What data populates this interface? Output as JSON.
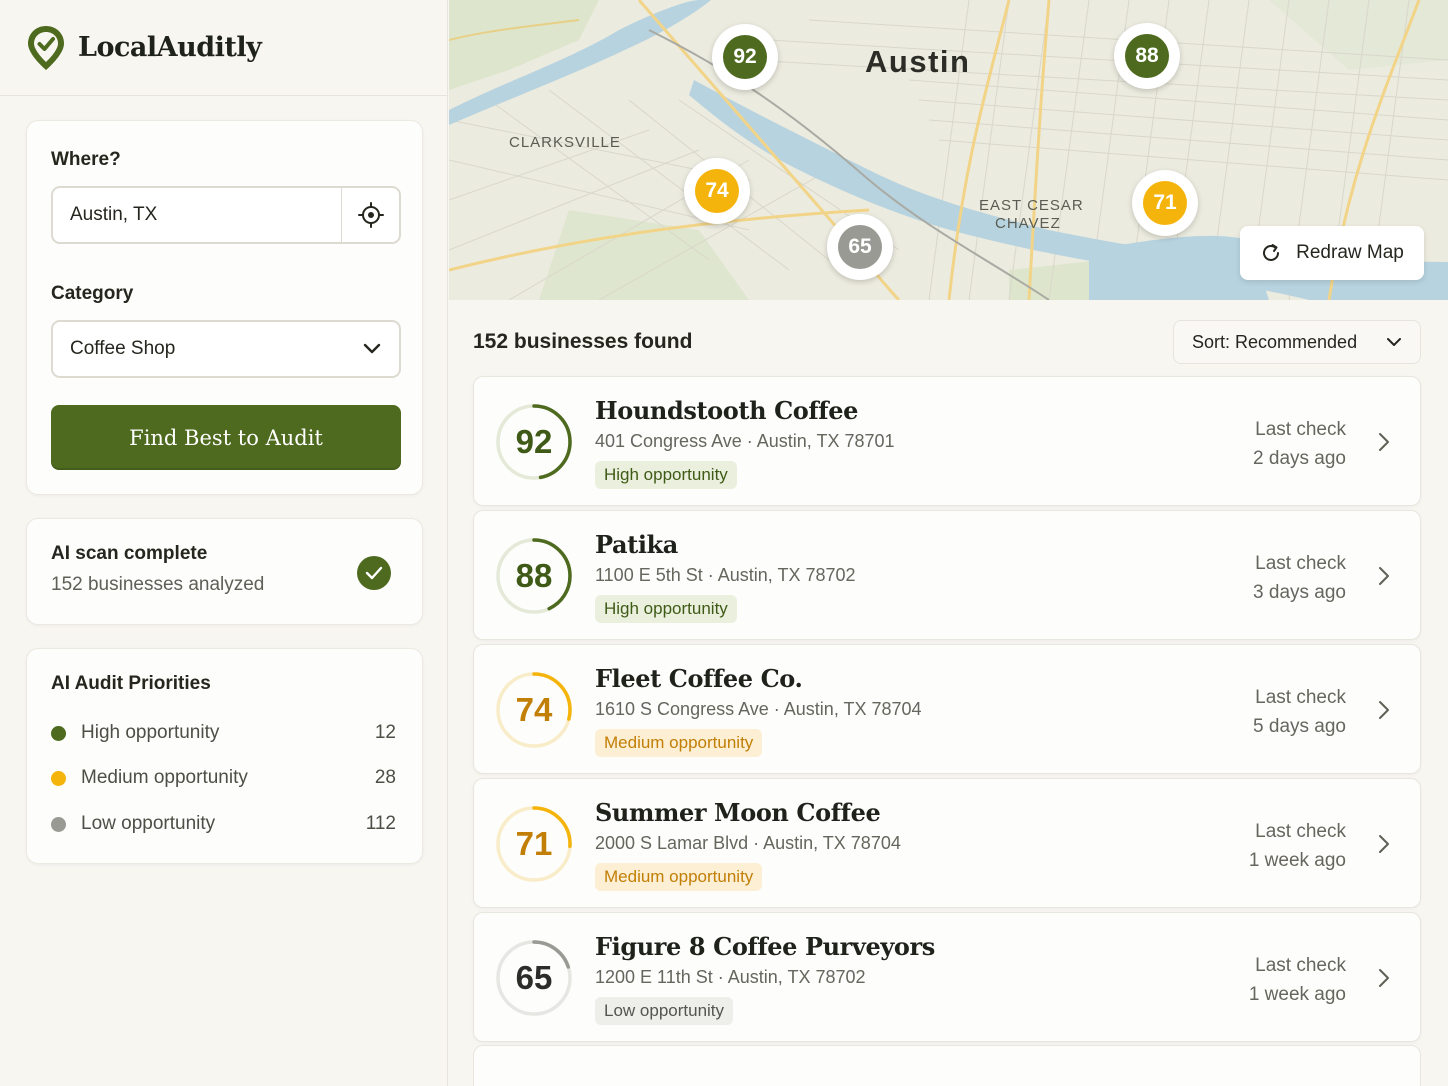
{
  "brand": {
    "name": "LocalAuditly",
    "icon": "map-pin-check-icon",
    "color": "#4d6a1e"
  },
  "search": {
    "where_label": "Where?",
    "location_value": "Austin, TX",
    "category_label": "Category",
    "category_value": "Coffee Shop",
    "submit_label": "Find Best to Audit"
  },
  "scan": {
    "title": "AI scan complete",
    "subtitle": "152 businesses analyzed"
  },
  "priorities": {
    "title": "AI Audit Priorities",
    "items": [
      {
        "label": "High opportunity",
        "count": "12",
        "color": "#4d6a1e"
      },
      {
        "label": "Medium opportunity",
        "count": "28",
        "color": "#f5b40b"
      },
      {
        "label": "Low opportunity",
        "count": "112",
        "color": "#9a9a94"
      }
    ]
  },
  "map": {
    "city_label": "Austin",
    "district_labels": [
      "CLARKSVILLE",
      "EAST CESAR",
      "CHAVEZ"
    ],
    "markers": [
      {
        "score": "92",
        "level": "high"
      },
      {
        "score": "88",
        "level": "high"
      },
      {
        "score": "74",
        "level": "medium"
      },
      {
        "score": "71",
        "level": "medium"
      },
      {
        "score": "65",
        "level": "low"
      }
    ],
    "redraw_label": "Redraw Map"
  },
  "results": {
    "count_label": "152 businesses found",
    "sort_label": "Sort: Recommended",
    "items": [
      {
        "score": "92",
        "score_value": 92,
        "name": "Houndstooth Coffee",
        "address": "401 Congress Ave · Austin, TX 78701",
        "badge": "High opportunity",
        "level": "high",
        "check_label": "Last check",
        "check_time": "2 days ago"
      },
      {
        "score": "88",
        "score_value": 88,
        "name": "Patika",
        "address": "1100 E 5th St · Austin, TX 78702",
        "badge": "High opportunity",
        "level": "high",
        "check_label": "Last check",
        "check_time": "3 days ago"
      },
      {
        "score": "74",
        "score_value": 74,
        "name": "Fleet Coffee Co.",
        "address": "1610 S Congress Ave · Austin, TX 78704",
        "badge": "Medium opportunity",
        "level": "medium",
        "check_label": "Last check",
        "check_time": "5 days ago"
      },
      {
        "score": "71",
        "score_value": 71,
        "name": "Summer Moon Coffee",
        "address": "2000 S Lamar Blvd · Austin, TX 78704",
        "badge": "Medium opportunity",
        "level": "medium",
        "check_label": "Last check",
        "check_time": "1 week ago"
      },
      {
        "score": "65",
        "score_value": 65,
        "name": "Figure 8 Coffee Purveyors",
        "address": "1200 E 11th St · Austin, TX 78702",
        "badge": "Low opportunity",
        "level": "low",
        "check_label": "Last check",
        "check_time": "1 week ago"
      }
    ]
  },
  "colors": {
    "high": "#4d6a1e",
    "high_text": "#3f5a17",
    "medium": "#f5b40b",
    "medium_text": "#c27f07",
    "low": "#9a9a94",
    "low_text": "#2c2c28"
  }
}
